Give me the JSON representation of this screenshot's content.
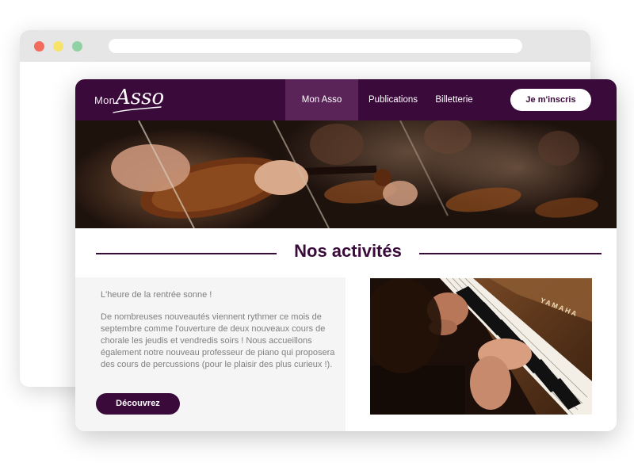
{
  "brand": {
    "prefix": "Mon",
    "name": "Asso"
  },
  "nav": {
    "items": [
      {
        "label": "Mon Asso",
        "active": true
      },
      {
        "label": "Publications",
        "active": false
      },
      {
        "label": "Billetterie",
        "active": false
      }
    ],
    "signup_label": "Je m'inscris"
  },
  "section": {
    "title": "Nos activités",
    "intro": "L'heure de la rentrée sonne !",
    "body": "De nombreuses nouveautés viennent rythmer ce mois de septembre comme l'ouverture de deux nouveaux cours de chorale les jeudis et vendredis soirs ! Nous accueillons également notre nouveau professeur de piano qui proposera des cours de percussions (pour le plaisir des plus curieux !).",
    "cta_label": "Découvrez"
  },
  "photos": {
    "piano_brand": "YAMAHA"
  },
  "colors": {
    "brand": "#3a0a3a",
    "nav_active": "#5a2459",
    "dot_red": "#f26b5b",
    "dot_yellow": "#f7e36a",
    "dot_green": "#8fd3a5"
  },
  "icons": {
    "window_dots": [
      "close-dot",
      "minimize-dot",
      "maximize-dot"
    ]
  }
}
